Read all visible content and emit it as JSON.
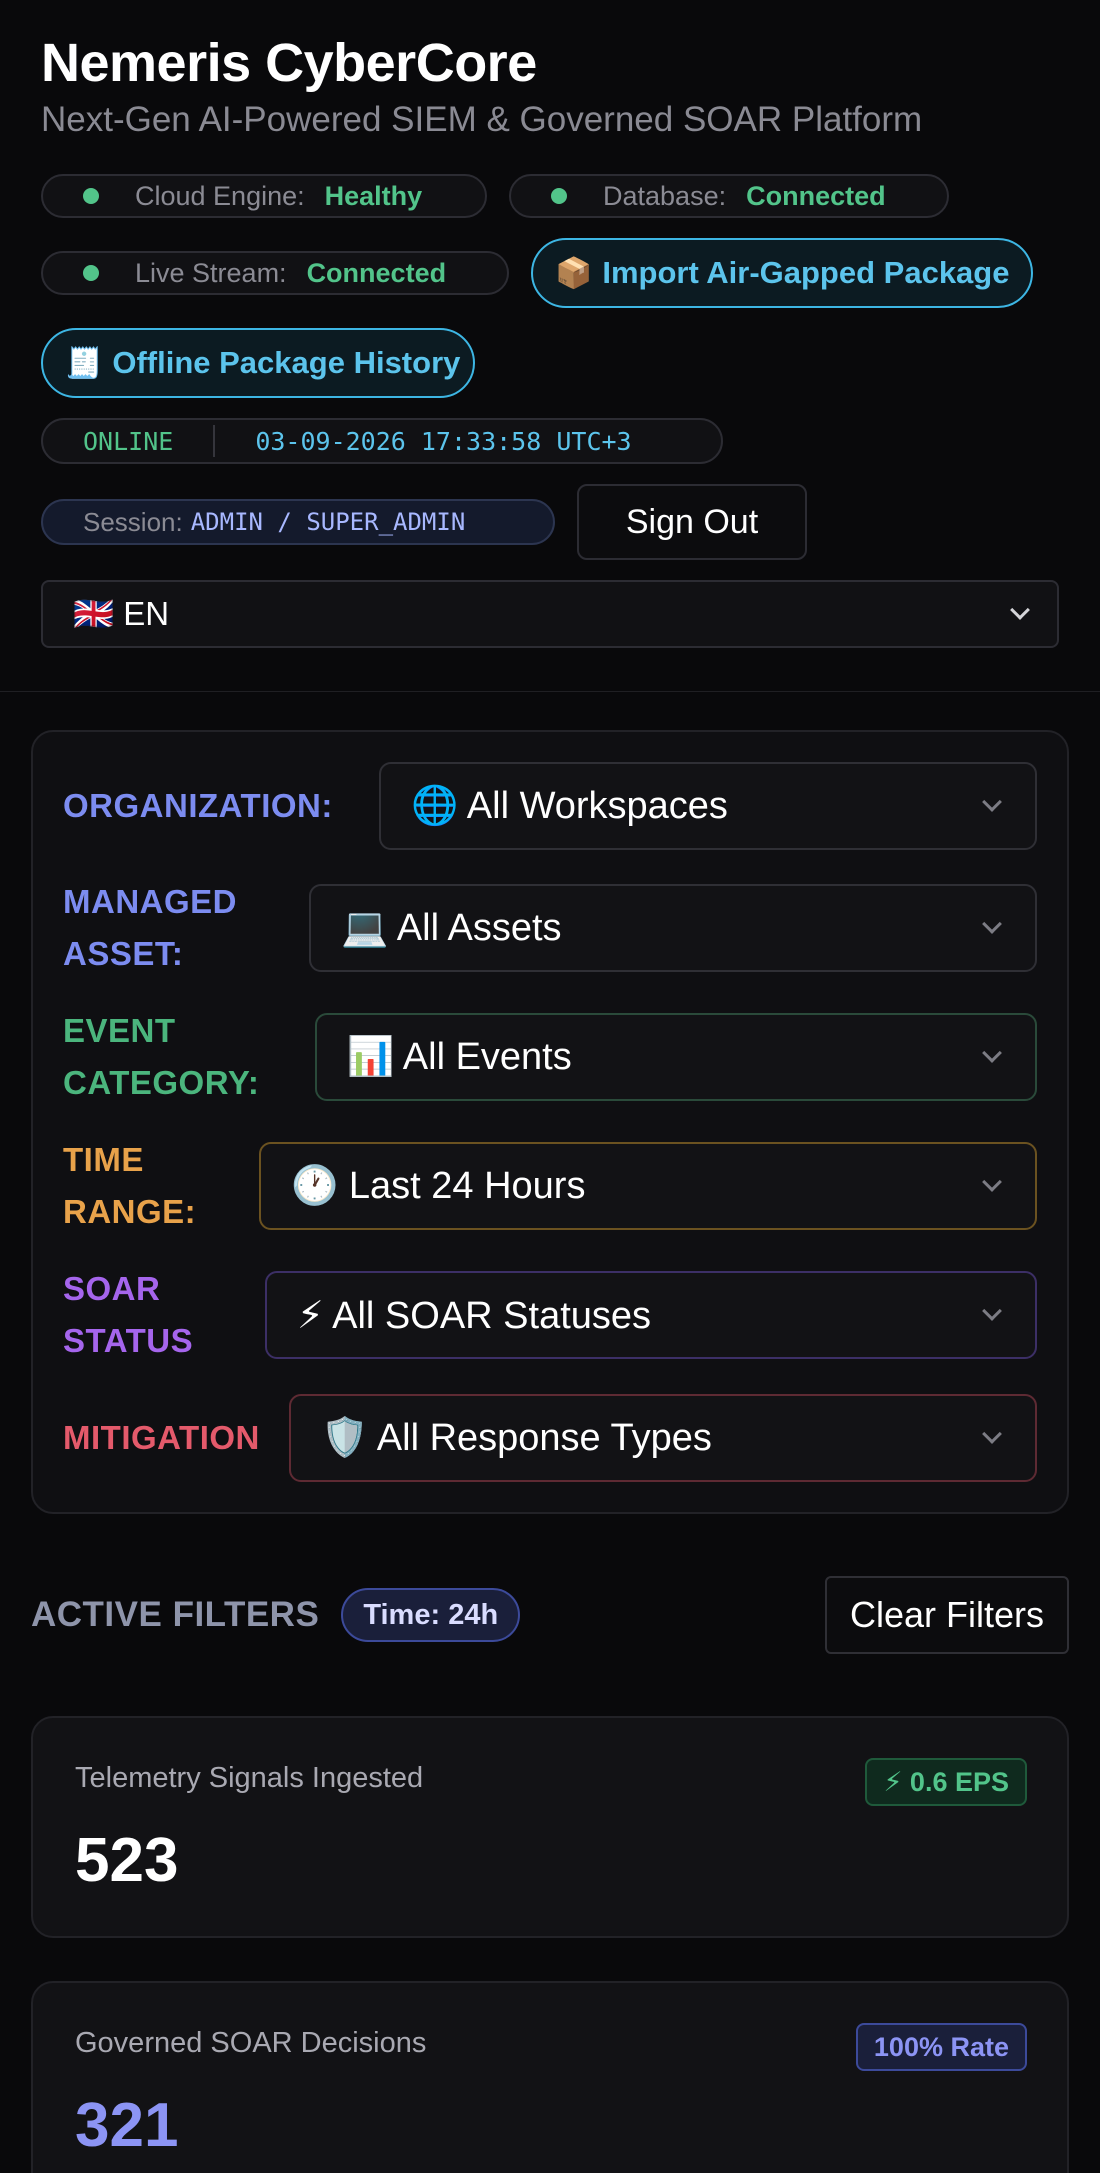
{
  "header": {
    "title": "Nemeris CyberCore",
    "subtitle": "Next-Gen AI-Powered SIEM & Governed SOAR Platform"
  },
  "status": {
    "cloud_engine": {
      "label": "Cloud Engine:",
      "value": "Healthy"
    },
    "database": {
      "label": "Database:",
      "value": "Connected"
    },
    "live_stream": {
      "label": "Live Stream:",
      "value": "Connected"
    }
  },
  "actions": {
    "import_icon": "📦",
    "import_label": "Import Air-Gapped Package",
    "history_icon": "🧾",
    "history_label": "Offline Package History"
  },
  "clock": {
    "state": "ONLINE",
    "datetime": "03-09-2026 17:33:58 UTC+3"
  },
  "session": {
    "label": "Session:",
    "value": "ADMIN / SUPER_ADMIN",
    "sign_out": "Sign Out"
  },
  "language": {
    "selected": "🇬🇧 EN"
  },
  "filters": {
    "organization": {
      "label": "ORGANIZATION:",
      "value": "🌐 All Workspaces"
    },
    "asset": {
      "label_line1": "MANAGED",
      "label_line2": "ASSET:",
      "value": "💻 All Assets"
    },
    "event": {
      "label_line1": "EVENT",
      "label_line2": "CATEGORY:",
      "value": "📊 All Events"
    },
    "time": {
      "label_line1": "TIME",
      "label_line2": "RANGE:",
      "value": "🕐 Last 24 Hours"
    },
    "soar": {
      "label_line1": "SOAR",
      "label_line2": "STATUS",
      "value": "⚡ All SOAR Statuses"
    },
    "mitigation": {
      "label": "MITIGATION",
      "value": "🛡️ All Response Types"
    }
  },
  "active_filters": {
    "title": "ACTIVE FILTERS",
    "tags": [
      "Time: 24h"
    ],
    "clear_label": "Clear Filters"
  },
  "kpis": [
    {
      "label": "Telemetry Signals Ingested",
      "value": "523",
      "badge": "⚡ 0.6 EPS"
    },
    {
      "label": "Governed SOAR Decisions",
      "value": "321",
      "badge": "100% Rate"
    }
  ],
  "colors": {
    "healthy_green": "#52c48a",
    "accent_cyan": "#5cc4ec",
    "organization": "#7c8cf0",
    "event": "#4bb57d",
    "time": "#e8a24a",
    "soar": "#a565ec",
    "mitigation": "#e45a6b"
  }
}
